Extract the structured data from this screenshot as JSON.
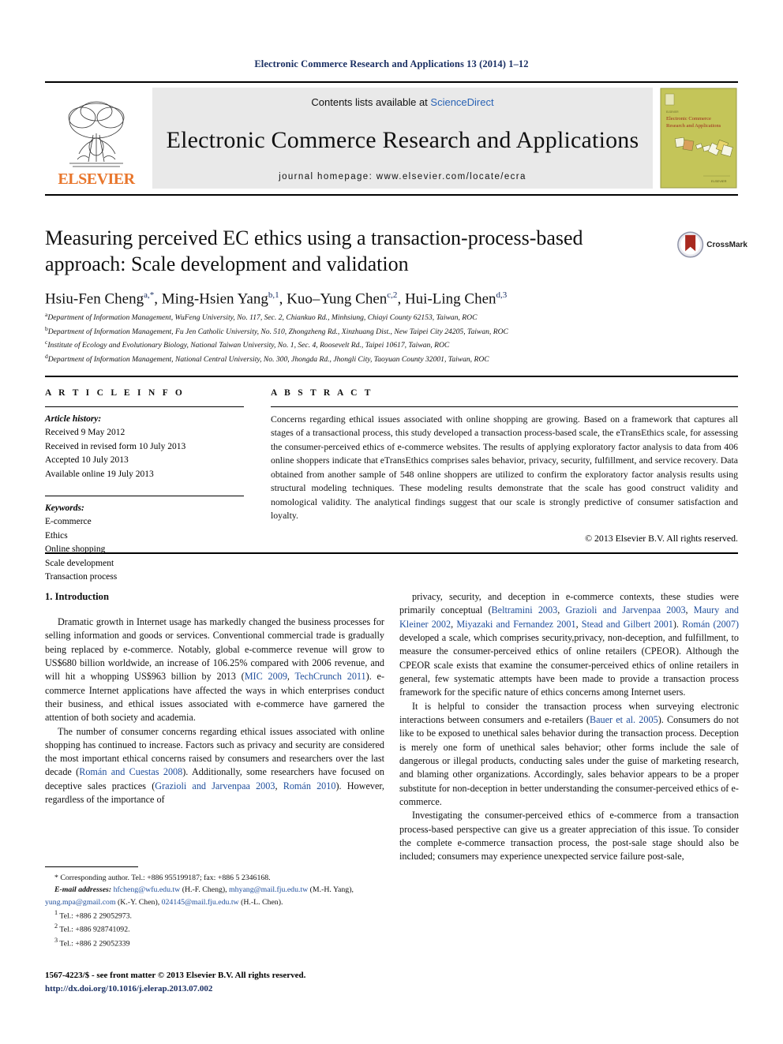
{
  "running_head": "Electronic Commerce Research and Applications 13 (2014) 1–12",
  "masthead": {
    "contents_prefix": "Contents lists available at ",
    "sciencedirect": "ScienceDirect",
    "journal_title": "Electronic Commerce Research and Applications",
    "homepage": "journal homepage: www.elsevier.com/locate/ecra",
    "publisher": "ELSEVIER",
    "cover_title_line1": "Electronic Commerce",
    "cover_title_line2": "Research and Applications"
  },
  "article": {
    "title": "Measuring perceived EC ethics using a transaction-process-based approach: Scale development and validation",
    "authors_html": "Hsiu-Fen Cheng<sup>a,*</sup>, Ming-Hsien Yang<sup>b,1</sup>, Kuo–Yung Chen<sup>c,2</sup>, Hui-Ling Chen<sup>d,3</sup>",
    "crossmark_label": "CrossMark",
    "affiliations": [
      {
        "marker": "a",
        "text": "Department of Information Management, WuFeng University, No. 117, Sec. 2, Chiankuo Rd., Minhsiung, Chiayi County 62153, Taiwan, ROC"
      },
      {
        "marker": "b",
        "text": "Department of Information Management, Fu Jen Catholic University, No. 510, Zhongzheng Rd., Xinzhuang Dist., New Taipei City 24205, Taiwan, ROC"
      },
      {
        "marker": "c",
        "text": "Institute of Ecology and Evolutionary Biology, National Taiwan University, No. 1, Sec. 4, Roosevelt Rd., Taipei 10617, Taiwan, ROC"
      },
      {
        "marker": "d",
        "text": "Department of Information Management, National Central University, No. 300, Jhongda Rd., Jhongli City, Taoyuan County 32001, Taiwan, ROC"
      }
    ]
  },
  "article_info": {
    "heading": "A R T I C L E   I N F O",
    "history_label": "Article history:",
    "history": [
      "Received 9 May 2012",
      "Received in revised form 10 July 2013",
      "Accepted 10 July 2013",
      "Available online 19 July 2013"
    ],
    "keywords_label": "Keywords:",
    "keywords": [
      "E-commerce",
      "Ethics",
      "Online shopping",
      "Scale development",
      "Transaction process"
    ]
  },
  "abstract": {
    "heading": "A B S T R A C T",
    "text": "Concerns regarding ethical issues associated with online shopping are growing. Based on a framework that captures all stages of a transactional process, this study developed a transaction process-based scale, the eTransEthics scale, for assessing the consumer-perceived ethics of e-commerce websites. The results of applying exploratory factor analysis to data from 406 online shoppers indicate that eTransEthics comprises sales behavior, privacy, security, fulfillment, and service recovery. Data obtained from another sample of 548 online shoppers are utilized to confirm the exploratory factor analysis results using structural modeling techniques. These modeling results demonstrate that the scale has good construct validity and nomological validity. The analytical findings suggest that our scale is strongly predictive of consumer satisfaction and loyalty.",
    "copyright": "© 2013 Elsevier B.V. All rights reserved."
  },
  "body": {
    "section_heading": "1. Introduction",
    "left_paragraphs": [
      "Dramatic growth in Internet usage has markedly changed the business processes for selling information and goods or services. Conventional commercial trade is gradually being replaced by e-commerce. Notably, global e-commerce revenue will grow to US$680 billion worldwide, an increase of 106.25% compared with 2006 revenue, and will hit a whopping US$963 billion by 2013 (MIC 2009, TechCrunch 2011). e-commerce Internet applications have affected the ways in which enterprises conduct their business, and ethical issues associated with e-commerce have garnered the attention of both society and academia.",
      "The number of consumer concerns regarding ethical issues associated with online shopping has continued to increase. Factors such as privacy and security are considered the most important ethical concerns raised by consumers and researchers over the last decade (Román and Cuestas 2008). Additionally, some researchers have focused on deceptive sales practices (Grazioli and Jarvenpaa 2003, Román 2010). However, regardless of the importance of"
    ],
    "right_paragraphs": [
      "privacy, security, and deception in e-commerce contexts, these studies were primarily conceptual (Beltramini 2003, Grazioli and Jarvenpaa 2003, Maury and Kleiner 2002, Miyazaki and Fernandez 2001, Stead and Gilbert 2001). Román (2007) developed a scale, which comprises security,privacy, non-deception, and fulfillment, to measure the consumer-perceived ethics of online retailers (CPEOR). Although the CPEOR scale exists that examine the consumer-perceived ethics of online retailers in general, few systematic attempts have been made to provide a transaction process framework for the specific nature of ethics concerns among Internet users.",
      "It is helpful to consider the transaction process when surveying electronic interactions between consumers and e-retailers (Bauer et al. 2005). Consumers do not like to be exposed to unethical sales behavior during the transaction process. Deception is merely one form of unethical sales behavior; other forms include the sale of dangerous or illegal products, conducting sales under the guise of marketing research, and blaming other organizations. Accordingly, sales behavior appears to be a proper substitute for non-deception in better understanding the consumer-perceived ethics of e-commerce.",
      "Investigating the consumer-perceived ethics of e-commerce from a transaction process-based perspective can give us a greater appreciation of this issue. To consider the complete e-commerce transaction process, the post-sale stage should also be included; consumers may experience unexpected service failure post-sale,"
    ]
  },
  "footnotes": {
    "corresponding": "* Corresponding author. Tel.: +886 955199187; fax: +886 5 2346168.",
    "email_label": "E-mail addresses:",
    "emails": [
      {
        "address": "hfcheng@wfu.edu.tw",
        "person": "(H.-F. Cheng)"
      },
      {
        "address": "mhyang@mail.fju.edu.tw",
        "person": "(M.-H. Yang)"
      },
      {
        "address": "yung.mpa@gmail.com",
        "person": "(K.-Y. Chen)"
      },
      {
        "address": "024145@mail.fju.edu.tw",
        "person": "(H.-L. Chen)."
      }
    ],
    "numbered": [
      {
        "marker": "1",
        "text": "Tel.: +886 2 29052973."
      },
      {
        "marker": "2",
        "text": "Tel.: +886 928741092."
      },
      {
        "marker": "3",
        "text": "Tel.: +886 2 29052339"
      }
    ]
  },
  "page_footer": {
    "issn_line": "1567-4223/$ - see front matter © 2013 Elsevier B.V. All rights reserved.",
    "doi": "http://dx.doi.org/10.1016/j.elerap.2013.07.002"
  },
  "colors": {
    "running_head": "#1a2f63",
    "reference_link": "#1f4e9c",
    "elsevier_orange": "#E8762C",
    "band_gray": "#e9e9e9",
    "cover_green": "#c4c559"
  }
}
